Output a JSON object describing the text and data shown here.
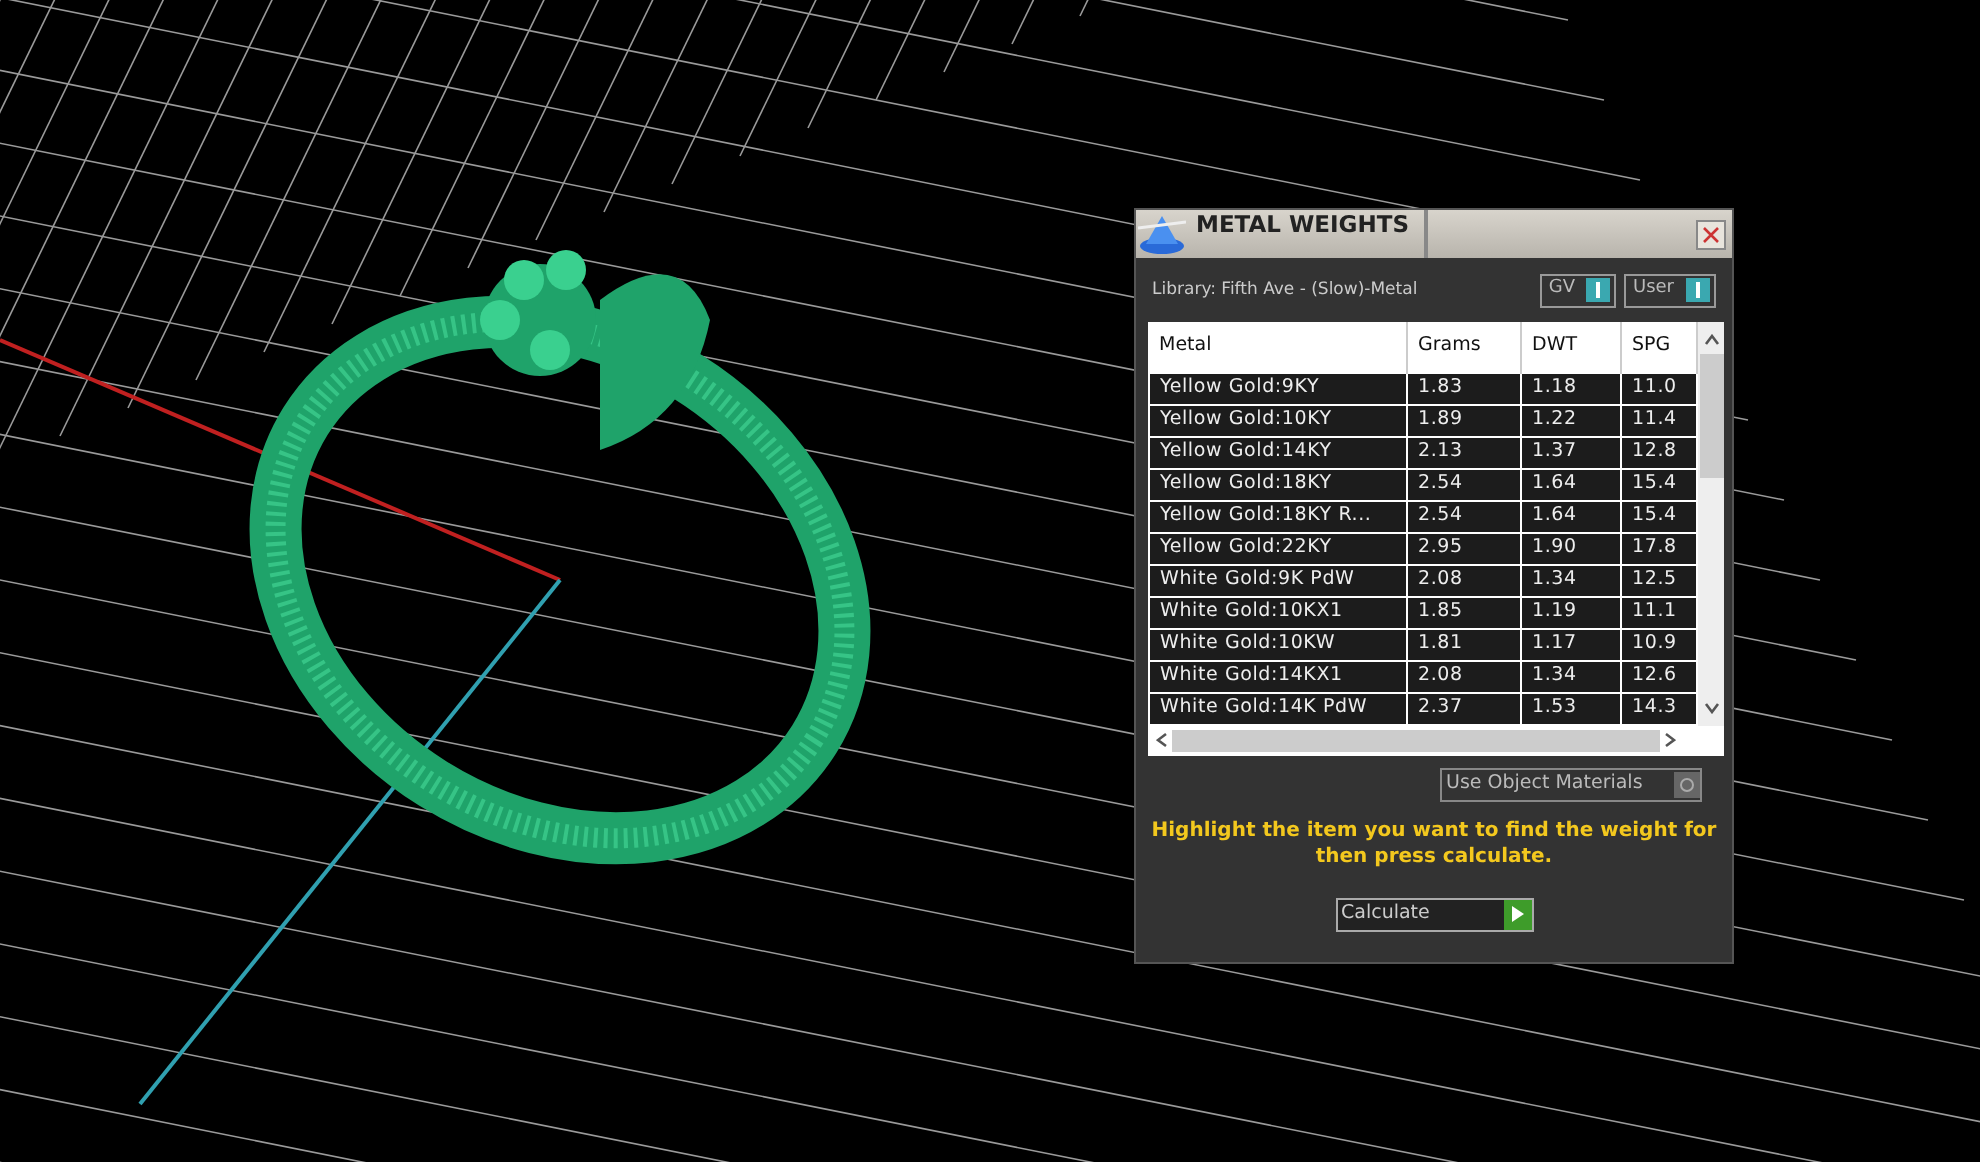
{
  "window": {
    "title": "METAL WEIGHTS"
  },
  "library": "Library: Fifth Ave - (Slow)-Metal",
  "toggles": [
    {
      "label": "GV",
      "on": true
    },
    {
      "label": "User",
      "on": true
    }
  ],
  "table": {
    "columns": [
      "Metal",
      "Grams",
      "DWT",
      "SPG"
    ],
    "rows": [
      [
        "Yellow Gold:9KY",
        "1.83",
        "1.18",
        "11.0"
      ],
      [
        "Yellow Gold:10KY",
        "1.89",
        "1.22",
        "11.4"
      ],
      [
        "Yellow Gold:14KY",
        "2.13",
        "1.37",
        "12.8"
      ],
      [
        "Yellow Gold:18KY",
        "2.54",
        "1.64",
        "15.4"
      ],
      [
        "Yellow Gold:18KY R...",
        "2.54",
        "1.64",
        "15.4"
      ],
      [
        "Yellow Gold:22KY",
        "2.95",
        "1.90",
        "17.8"
      ],
      [
        "White Gold:9K PdW",
        "2.08",
        "1.34",
        "12.5"
      ],
      [
        "White Gold:10KX1",
        "1.85",
        "1.19",
        "11.1"
      ],
      [
        "White Gold:10KW",
        "1.81",
        "1.17",
        "10.9"
      ],
      [
        "White Gold:14KX1",
        "2.08",
        "1.34",
        "12.6"
      ],
      [
        "White Gold:14K PdW",
        "2.37",
        "1.53",
        "14.3"
      ]
    ]
  },
  "use_object_materials": {
    "label": "Use Object Materials",
    "checked": false
  },
  "hint": "Highlight the item you want to find the weight for then press calculate.",
  "calculate_button": "Calculate"
}
